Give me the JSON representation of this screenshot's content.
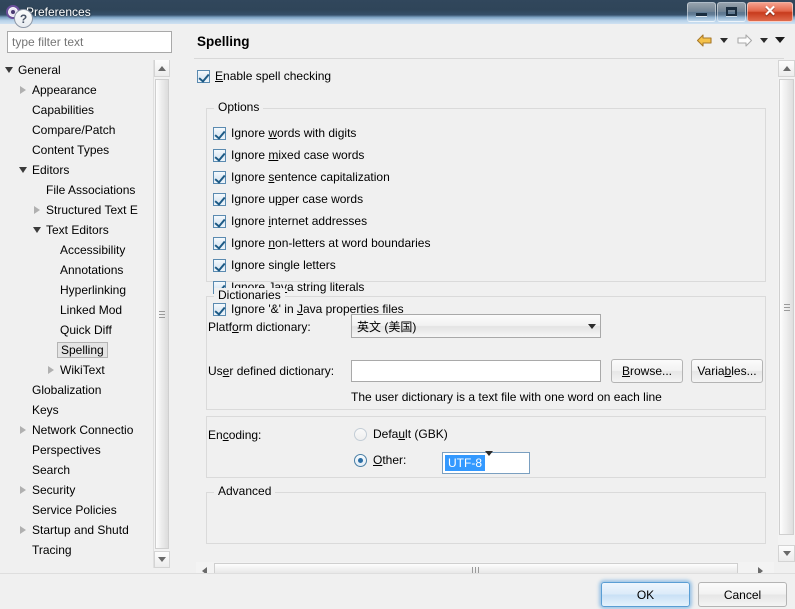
{
  "window": {
    "title": "Preferences",
    "icon": "preferences-gear-icon",
    "controls": {
      "minimize": "minimize-icon",
      "maximize": "maximize-icon",
      "close": "close-icon",
      "close_glyph": "✕"
    }
  },
  "sidebar": {
    "filter": {
      "value": "",
      "placeholder": "type filter text"
    },
    "tree": [
      {
        "label": "General",
        "indent": 0,
        "state": "expanded",
        "selected": false
      },
      {
        "label": "Appearance",
        "indent": 1,
        "state": "collapsed",
        "selected": false
      },
      {
        "label": "Capabilities",
        "indent": 1,
        "state": "leaf",
        "selected": false
      },
      {
        "label": "Compare/Patch",
        "indent": 1,
        "state": "leaf",
        "selected": false
      },
      {
        "label": "Content Types",
        "indent": 1,
        "state": "leaf",
        "selected": false
      },
      {
        "label": "Editors",
        "indent": 1,
        "state": "expanded",
        "selected": false
      },
      {
        "label": "File Associations",
        "indent": 2,
        "state": "leaf",
        "selected": false
      },
      {
        "label": "Structured Text E",
        "indent": 2,
        "state": "collapsed",
        "selected": false
      },
      {
        "label": "Text Editors",
        "indent": 2,
        "state": "expanded",
        "selected": false
      },
      {
        "label": "Accessibility",
        "indent": 3,
        "state": "leaf",
        "selected": false
      },
      {
        "label": "Annotations",
        "indent": 3,
        "state": "leaf",
        "selected": false
      },
      {
        "label": "Hyperlinking",
        "indent": 3,
        "state": "leaf",
        "selected": false
      },
      {
        "label": "Linked Mod",
        "indent": 3,
        "state": "leaf",
        "selected": false
      },
      {
        "label": "Quick Diff",
        "indent": 3,
        "state": "leaf",
        "selected": false
      },
      {
        "label": "Spelling",
        "indent": 3,
        "state": "leaf",
        "selected": true
      },
      {
        "label": "WikiText",
        "indent": 3,
        "state": "collapsed",
        "selected": false
      },
      {
        "label": "Globalization",
        "indent": 1,
        "state": "leaf",
        "selected": false
      },
      {
        "label": "Keys",
        "indent": 1,
        "state": "leaf",
        "selected": false
      },
      {
        "label": "Network Connectio",
        "indent": 1,
        "state": "collapsed",
        "selected": false
      },
      {
        "label": "Perspectives",
        "indent": 1,
        "state": "leaf",
        "selected": false
      },
      {
        "label": "Search",
        "indent": 1,
        "state": "leaf",
        "selected": false
      },
      {
        "label": "Security",
        "indent": 1,
        "state": "collapsed",
        "selected": false
      },
      {
        "label": "Service Policies",
        "indent": 1,
        "state": "leaf",
        "selected": false
      },
      {
        "label": "Startup and Shutd",
        "indent": 1,
        "state": "collapsed",
        "selected": false
      },
      {
        "label": "Tracing",
        "indent": 1,
        "state": "leaf",
        "selected": false
      }
    ],
    "scroll": {
      "up": "scroll-up-icon",
      "down": "scroll-down-icon",
      "left": "scroll-left-icon",
      "right": "scroll-right-icon"
    }
  },
  "panel": {
    "title": "Spelling",
    "nav": {
      "back": "back-arrow-icon",
      "back_menu": "back-dropdown-icon",
      "forward": "forward-arrow-icon",
      "forward_menu": "forward-dropdown-icon",
      "view_menu": "view-menu-icon"
    },
    "enable": {
      "label_pre": "",
      "mnemonic": "E",
      "label_post": "nable spell checking",
      "checked": true
    },
    "options": {
      "title": "Options",
      "items": [
        {
          "pre": "Ignore ",
          "mnemonic": "w",
          "post": "ords with digits",
          "checked": true
        },
        {
          "pre": "Ignore ",
          "mnemonic": "m",
          "post": "ixed case words",
          "checked": true
        },
        {
          "pre": "Ignore ",
          "mnemonic": "s",
          "post": "entence capitalization",
          "checked": true
        },
        {
          "pre": "Ignore u",
          "mnemonic": "p",
          "post": "per case words",
          "checked": true
        },
        {
          "pre": "Ignore ",
          "mnemonic": "i",
          "post": "nternet addresses",
          "checked": true
        },
        {
          "pre": "Ignore ",
          "mnemonic": "n",
          "post": "on-letters at word boundaries",
          "checked": true
        },
        {
          "pre": "I",
          "mnemonic": "g",
          "post": "nore single letters",
          "checked": true
        },
        {
          "pre": "Ignore Ja",
          "mnemonic": "v",
          "post": "a string literals",
          "checked": true
        },
        {
          "pre": "Ignore '&' in ",
          "mnemonic": "J",
          "post": "ava properties files",
          "checked": true
        }
      ]
    },
    "dictionaries": {
      "title": "Dictionaries",
      "platform_label_pre": "Platf",
      "platform_label_mn": "o",
      "platform_label_post": "rm dictionary:",
      "platform_value": "英文 (美国)",
      "platform_arrow": "chevron-down-icon",
      "user_label_pre": "Us",
      "user_label_mn": "e",
      "user_label_post": "r defined dictionary:",
      "user_value": "",
      "browse_pre": "",
      "browse_mn": "B",
      "browse_post": "rowse...",
      "variables_pre": "Varia",
      "variables_mn": "b",
      "variables_post": "les...",
      "hint": "The user dictionary is a text file with one word on each line"
    },
    "encoding": {
      "label_pre": "En",
      "label_mn": "c",
      "label_post": "oding:",
      "default_pre": "Defa",
      "default_mn": "u",
      "default_post": "lt (GBK)",
      "default_selected": false,
      "other_pre": "",
      "other_mn": "O",
      "other_post": "ther:",
      "other_selected": true,
      "other_value": "UTF-8",
      "other_arrow": "chevron-down-icon"
    },
    "advanced": {
      "title": "Advanced"
    }
  },
  "footer": {
    "help_icon": "help-icon",
    "help_glyph": "?",
    "ok": "OK",
    "cancel": "Cancel"
  }
}
